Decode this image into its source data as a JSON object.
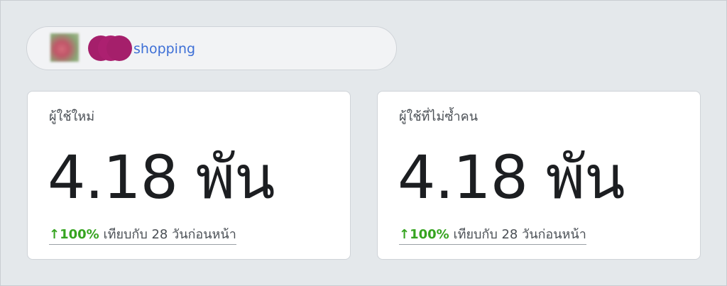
{
  "account": {
    "name": "shopping"
  },
  "cards": [
    {
      "title": "ผู้ใช้ใหม่",
      "value": "4.18 พัน",
      "change_arrow": "↑",
      "change_percent": "100%",
      "change_text": "เทียบกับ 28 วันก่อนหน้า"
    },
    {
      "title": "ผู้ใช้ที่ไม่ซ้ำคน",
      "value": "4.18 พัน",
      "change_arrow": "↑",
      "change_percent": "100%",
      "change_text": "เทียบกับ 28 วันก่อนหน้า"
    }
  ],
  "colors": {
    "positive": "#36a420",
    "link": "#3d6fd6",
    "redaction": "#a51f6b"
  }
}
